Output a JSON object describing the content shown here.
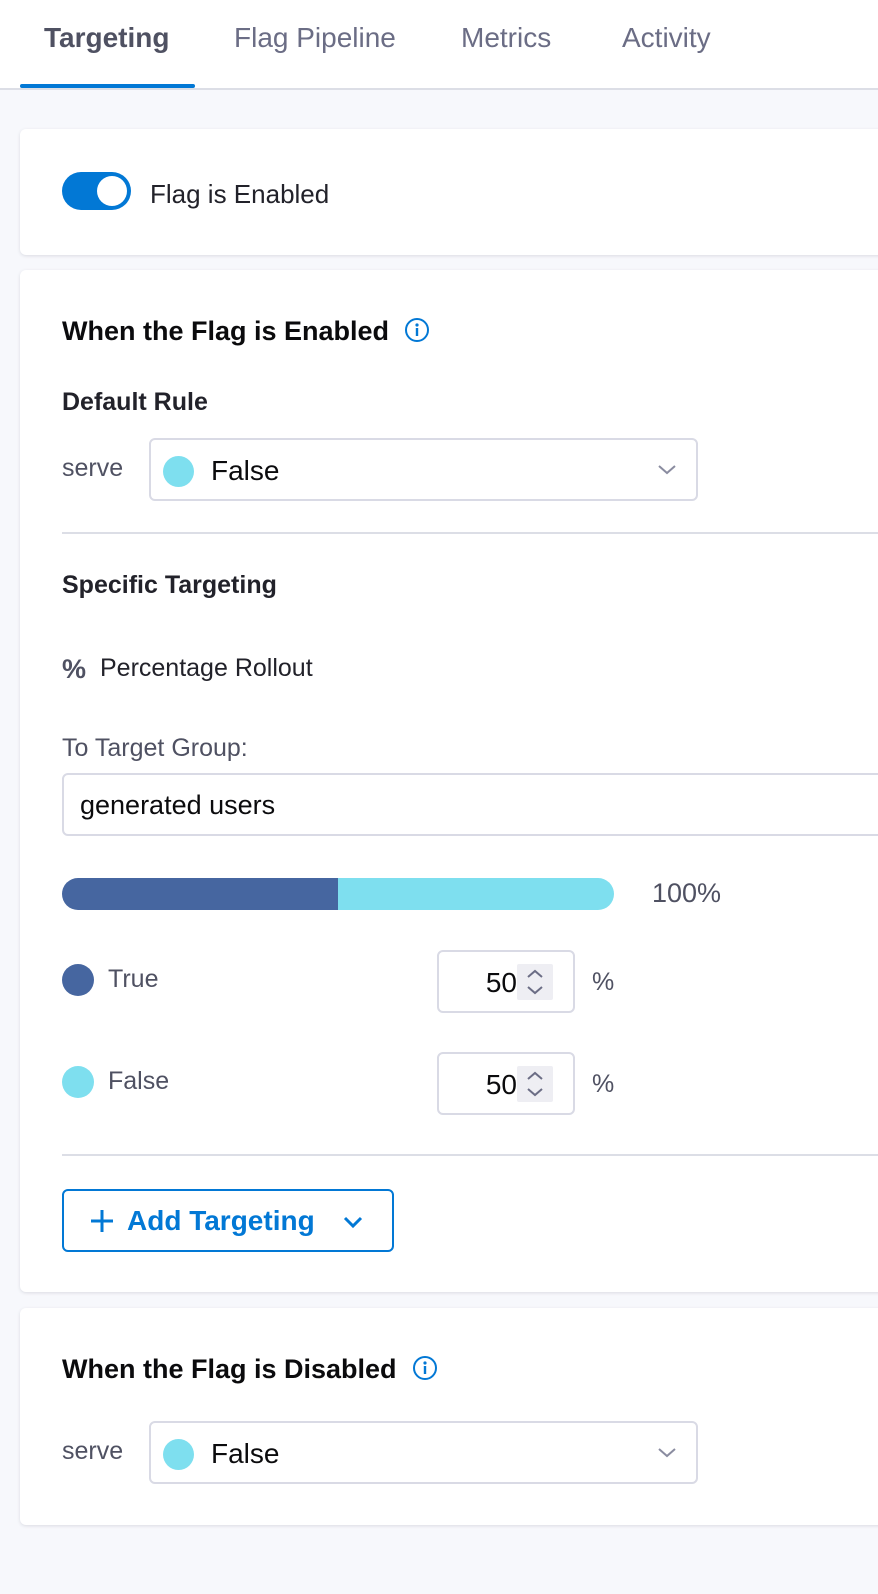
{
  "tabs": [
    {
      "label": "Targeting",
      "active": true
    },
    {
      "label": "Flag Pipeline",
      "active": false
    },
    {
      "label": "Metrics",
      "active": false
    },
    {
      "label": "Activity",
      "active": false
    }
  ],
  "toggle": {
    "label": "Flag is Enabled",
    "enabled": true
  },
  "enabled_section": {
    "title": "When the Flag is Enabled",
    "default_rule": {
      "heading": "Default Rule",
      "serve_label": "serve",
      "selected": "False",
      "selected_color": "#7edfef"
    },
    "specific_targeting": {
      "heading": "Specific Targeting",
      "rollout_symbol": "%",
      "rollout_label": "Percentage Rollout",
      "target_group_label": "To Target Group:",
      "target_group_value": "generated users",
      "total_label": "100%",
      "variations": [
        {
          "name": "True",
          "percent": "50",
          "color": "#4666a0"
        },
        {
          "name": "False",
          "percent": "50",
          "color": "#7edfef"
        }
      ],
      "percent_symbol": "%"
    },
    "add_targeting_label": "Add Targeting"
  },
  "disabled_section": {
    "title": "When the Flag is Disabled",
    "serve_label": "serve",
    "selected": "False",
    "selected_color": "#7edfef"
  },
  "colors": {
    "accent": "#0278d5",
    "true_variation": "#4666a0",
    "false_variation": "#7edfef"
  }
}
